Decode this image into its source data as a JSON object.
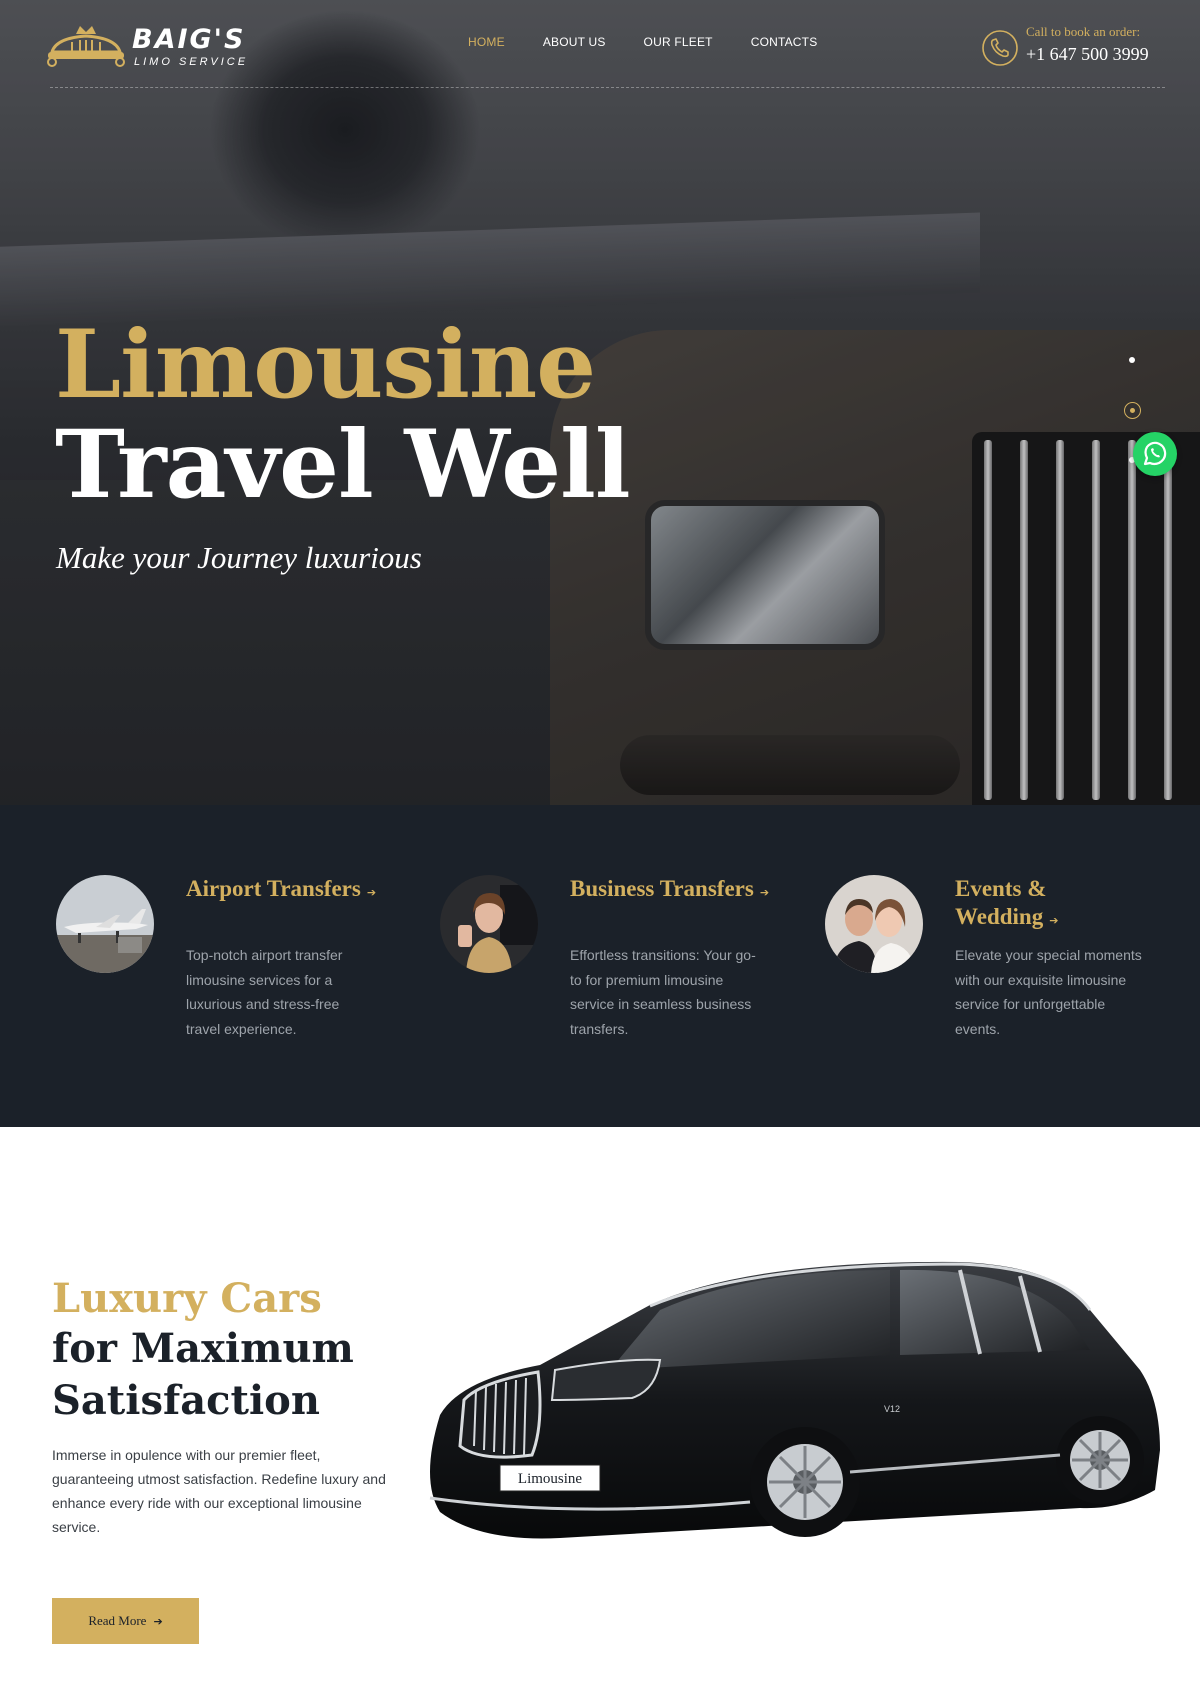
{
  "header": {
    "logo": {
      "title": "BAIG'S",
      "subtitle": "LIMO SERVICE"
    },
    "nav": [
      {
        "label": "HOME",
        "active": true
      },
      {
        "label": "ABOUT US",
        "active": false
      },
      {
        "label": "OUR FLEET",
        "active": false
      },
      {
        "label": "CONTACTS",
        "active": false
      }
    ],
    "call": {
      "label": "Call to book an order:",
      "phone": "+1 647 500 3999",
      "icon": "phone-icon"
    }
  },
  "hero": {
    "title_line1": "Limousine",
    "title_line2": "Travel Well",
    "tagline": "Make your Journey luxurious",
    "slider": {
      "slides": 3,
      "active": 2
    },
    "chat_icon": "whatsapp-icon"
  },
  "services": [
    {
      "title": "Airport Transfers",
      "desc": "Top-notch airport transfer limousine services for a luxurious and stress-free travel experience.",
      "image": "airplane"
    },
    {
      "title": "Business Transfers",
      "desc": "Effortless transitions: Your go-to for premium limousine service in seamless business transfers.",
      "image": "businesswoman"
    },
    {
      "title": "Events & Wedding",
      "desc": "Elevate your special moments with our exquisite limousine service for unforgettable events.",
      "image": "wedding-couple"
    }
  ],
  "luxury": {
    "title_line1": "Luxury Cars",
    "title_line2": "for Maximum",
    "title_line3": "Satisfaction",
    "desc": "Immerse in opulence with our premier fleet, guaranteeing utmost satisfaction. Redefine luxury and enhance every ride with our exceptional limousine service.",
    "button": "Read More",
    "plate": "Limousine",
    "badge": "V12"
  },
  "colors": {
    "gold": "#d3b05f",
    "navy": "#1b2129",
    "whatsapp": "#25d366"
  }
}
